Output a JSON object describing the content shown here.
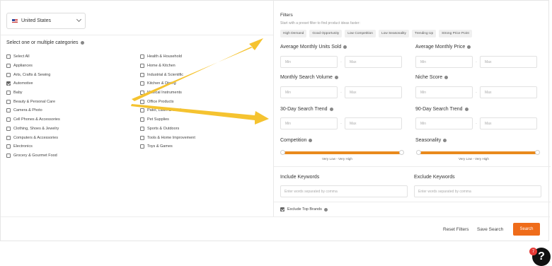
{
  "country": {
    "value": "United States"
  },
  "categories": {
    "title": "Select one or multiple categories",
    "left": [
      {
        "label": "Select All",
        "checked": false
      },
      {
        "label": "Appliances",
        "checked": false
      },
      {
        "label": "Arts, Crafts & Sewing",
        "checked": false
      },
      {
        "label": "Automotive",
        "checked": true
      },
      {
        "label": "Baby",
        "checked": false
      },
      {
        "label": "Beauty & Personal Care",
        "checked": false
      },
      {
        "label": "Camera & Photo",
        "checked": false
      },
      {
        "label": "Cell Phones & Accessories",
        "checked": false
      },
      {
        "label": "Clothing, Shoes & Jewelry",
        "checked": false
      },
      {
        "label": "Computers & Accessories",
        "checked": false
      },
      {
        "label": "Electronics",
        "checked": false
      },
      {
        "label": "Grocery & Gourmet Food",
        "checked": false
      }
    ],
    "right": [
      {
        "label": "Health & Household",
        "checked": false
      },
      {
        "label": "Home & Kitchen",
        "checked": false
      },
      {
        "label": "Industrial & Scientific",
        "checked": false
      },
      {
        "label": "Kitchen & Dining",
        "checked": false
      },
      {
        "label": "Musical Instruments",
        "checked": false
      },
      {
        "label": "Office Products",
        "checked": false
      },
      {
        "label": "Patio, Lawn & Garden",
        "checked": false
      },
      {
        "label": "Pet Supplies",
        "checked": false
      },
      {
        "label": "Sports & Outdoors",
        "checked": false
      },
      {
        "label": "Tools & Home Improvement",
        "checked": false
      },
      {
        "label": "Toys & Games",
        "checked": false
      }
    ]
  },
  "filters": {
    "title": "Filters",
    "subtitle": "Start with a preset filter to find product ideas faster:",
    "presets": [
      "High Demand",
      "Good Opportunity",
      "Low Competition",
      "Low Seasonality",
      "Trending Up",
      "Strong Price Point"
    ],
    "avg_units": "Average Monthly Units Sold",
    "avg_price": "Average Monthly Price",
    "search_volume": "Monthly Search Volume",
    "niche_score": "Niche Score",
    "trend_30": "30-Day Search Trend",
    "trend_90": "90-Day Search Trend",
    "competition": "Competition",
    "seasonality": "Seasonality",
    "min": "Min",
    "max": "Max",
    "dash": "-",
    "range_low": "Very Low",
    "range_sep": "-",
    "range_high": "Very High",
    "include_label": "Include Keywords",
    "exclude_label": "Exclude Keywords",
    "keywords_placeholder": "Enter words separated by comma",
    "exclude_brands": "Exclude Top Brands"
  },
  "actions": {
    "reset": "Reset Filters",
    "save": "Save Search",
    "search": "Search"
  },
  "help": {
    "badge": "7",
    "icon": "?"
  },
  "colors": {
    "accent": "#ef6c1a",
    "slider": "#e98a1d",
    "arrow": "#f5c330",
    "badge": "#e53935"
  }
}
